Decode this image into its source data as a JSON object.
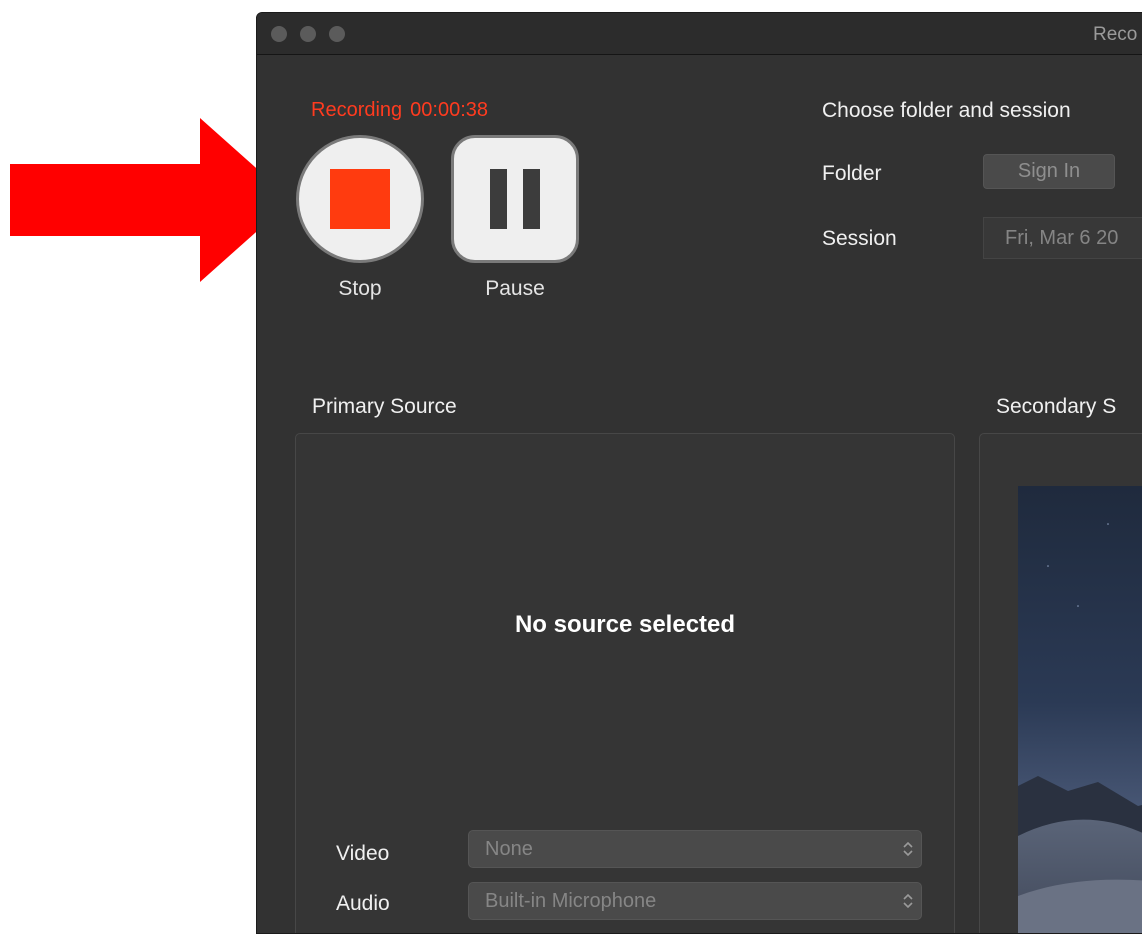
{
  "window": {
    "title": "Reco"
  },
  "recording": {
    "status": "Recording",
    "timer": "00:00:38"
  },
  "controls": {
    "stop_label": "Stop",
    "pause_label": "Pause"
  },
  "destination": {
    "heading": "Choose folder and session",
    "folder_label": "Folder",
    "sign_in_label": "Sign In",
    "session_label": "Session",
    "session_value": "Fri, Mar 6 20"
  },
  "primary_source": {
    "title": "Primary Source",
    "empty_message": "No source selected",
    "video_label": "Video",
    "video_value": "None",
    "audio_label": "Audio",
    "audio_value": "Built-in Microphone"
  },
  "secondary_source": {
    "title": "Secondary S"
  },
  "colors": {
    "recording_red": "#ff3b1f",
    "stop_square": "#ff3b0f",
    "annotation_arrow": "#ff0000",
    "window_bg": "#323232"
  },
  "icons": {
    "annotation": "red-arrow-icon",
    "stop": "stop-square-icon",
    "pause": "pause-icon",
    "select": "updown-chevron-icon"
  }
}
